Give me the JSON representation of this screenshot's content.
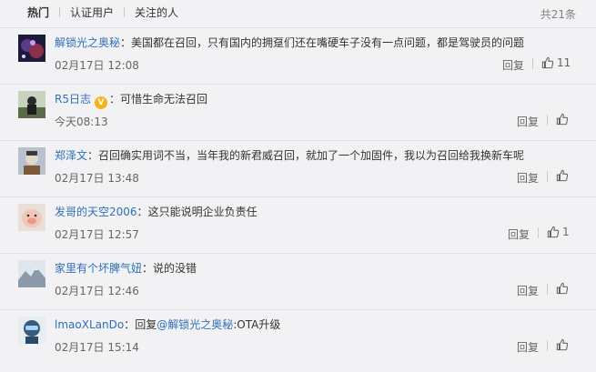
{
  "tabs": [
    {
      "label": "热门"
    },
    {
      "label": "认证用户"
    },
    {
      "label": "关注的人"
    }
  ],
  "total": "共21条",
  "comments": [
    {
      "user": "解锁光之奥秘",
      "colon": "：",
      "text": "美国都在召回，只有国内的拥趸们还在嘴硬车子没有一点问题，都是驾驶员的问题",
      "time": "02月17日 12:08",
      "reply": "回复",
      "likes": "11"
    },
    {
      "user": "R5日志",
      "verified": "V",
      "colon": "：",
      "text": "可惜生命无法召回",
      "time": "今天08:13",
      "reply": "回复",
      "likes": ""
    },
    {
      "user": "郑泽文",
      "colon": "：",
      "text": "召回确实用词不当，当年我的新君威召回，就加了一个加固件，我以为召回给我换新车呢",
      "time": "02月17日 13:48",
      "reply": "回复",
      "likes": ""
    },
    {
      "user": "发哥的天空2006",
      "colon": "：",
      "text": "这只能说明企业负责任",
      "time": "02月17日 12:57",
      "reply": "回复",
      "likes": "1"
    },
    {
      "user": "家里有个坏脾气妞",
      "colon": "：",
      "text": "说的没错",
      "time": "02月17日 12:46",
      "reply": "回复",
      "likes": ""
    },
    {
      "user": "lmaoXLanDo",
      "colon": "：",
      "text_prefix": "回复",
      "mention": "@解锁光之奥秘",
      "text": ":OTA升级",
      "time": "02月17日 15:14",
      "reply": "回复",
      "likes": ""
    }
  ],
  "icons": {
    "like": "thumbs-up-icon",
    "verified": "verified-badge-icon"
  },
  "colors": {
    "link": "#2e6fb8",
    "badge": "#f7b21b",
    "background": "#f2f2f5"
  }
}
